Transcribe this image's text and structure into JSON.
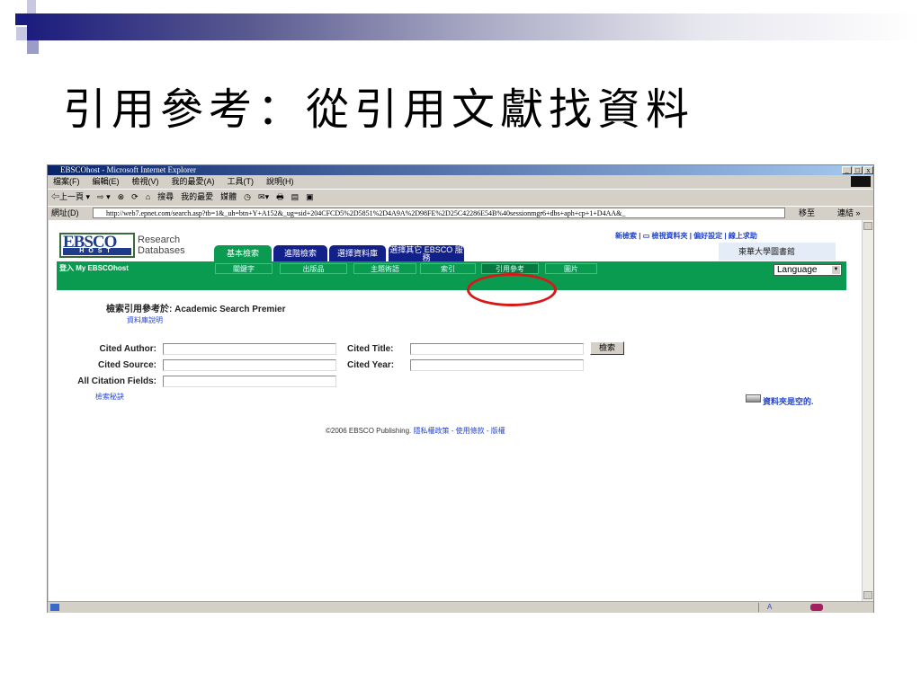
{
  "slide": {
    "title": "引用參考：從引用文獻找資料"
  },
  "browser": {
    "title": "EBSCOhost - Microsoft Internet Explorer",
    "window_buttons": [
      "_",
      "□",
      "x"
    ],
    "menu": [
      "檔案(F)",
      "編輯(E)",
      "檢視(V)",
      "我的最愛(A)",
      "工具(T)",
      "說明(H)"
    ],
    "toolbar": [
      "⇦上一頁 ▾",
      "⇨ ▾",
      "⊗",
      "⟳",
      "⌂",
      "搜尋",
      "我的最愛",
      "媒體",
      "◷",
      "✉▾",
      "🖶",
      "▤",
      "▣"
    ],
    "address_label": "網址(D)",
    "url": "http://web7.epnet.com/search.asp?tb=1&_uh=btn+Y+A152&_ug=sid+204CFCD5%2D5851%2D4A9A%2D98FE%2D25C42286E54B%40sessionmgr6+dbs+aph+cp+1+D4AA&_",
    "go_label": "移至",
    "links_label": "連結 »"
  },
  "page": {
    "logo": {
      "top": "EBSCO",
      "bottom": "HOST",
      "tagline1": "Research",
      "tagline2": "Databases"
    },
    "top_links": [
      "新檢索",
      "檢視資料夾",
      "偏好設定",
      "線上求助"
    ],
    "library_name": "東華大學圖書館",
    "tabs": [
      "基本檢索",
      "進階檢索",
      "選擇資料庫",
      "選擇其它 EBSCO 服務"
    ],
    "login": "登入 My EBSCOhost",
    "subtabs": [
      "關鍵字",
      "出版品",
      "主題術語",
      "索引",
      "引用參考",
      "圖片"
    ],
    "language": "Language",
    "heading": "檢索引用參考於: Academic Search Premier",
    "db_help": "資料庫說明",
    "fields": {
      "cited_author": "Cited Author:",
      "cited_title": "Cited Title:",
      "cited_source": "Cited Source:",
      "cited_year": "Cited Year:",
      "all_fields": "All Citation Fields:"
    },
    "search_button": "檢索",
    "tips": "檢索秘訣",
    "folder": "資料夾是空的.",
    "footer": {
      "copyright": "©2006 EBSCO Publishing.",
      "links": [
        "隱私權政策",
        "使用條款",
        "版權"
      ]
    }
  },
  "colors": {
    "green": "#0a9a50",
    "tab_blue": "#12208a",
    "highlight": "#d81818"
  }
}
